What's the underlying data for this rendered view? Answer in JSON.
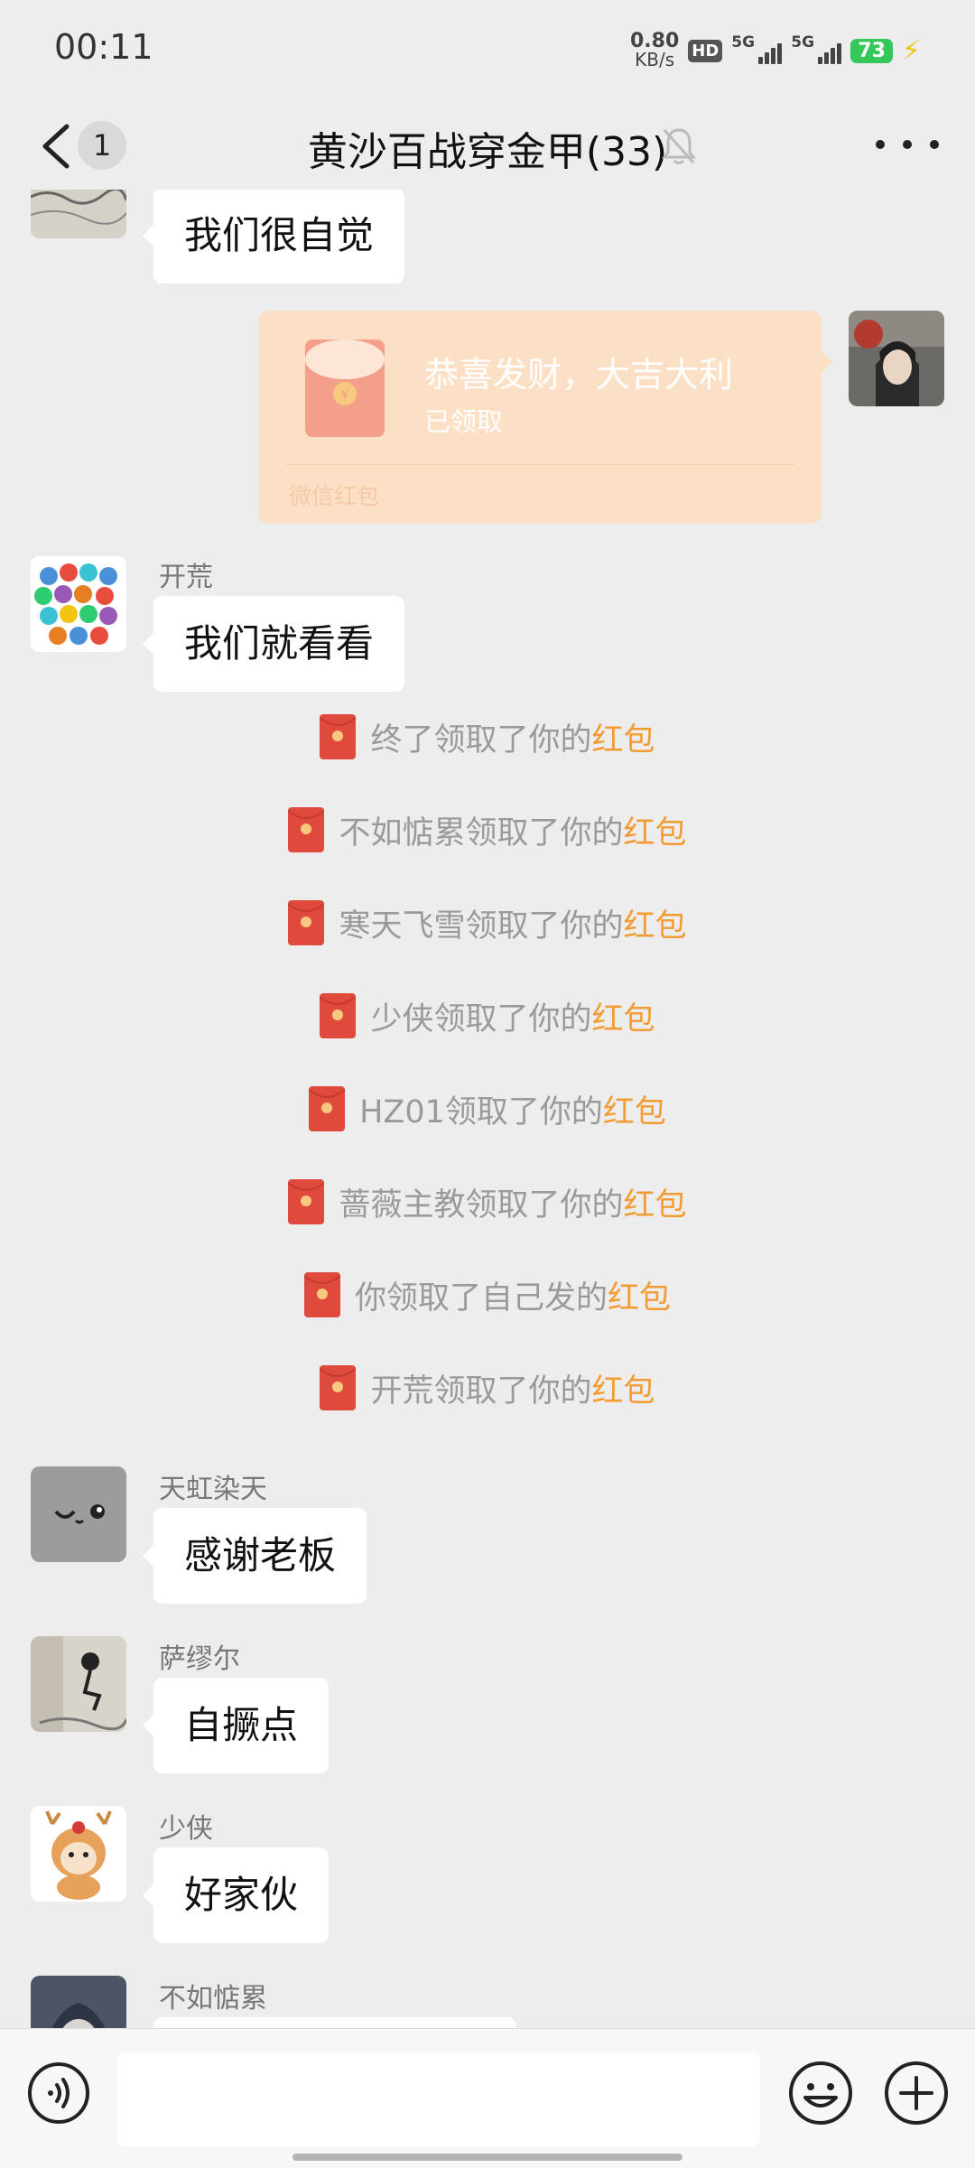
{
  "status_bar": {
    "time": "00:11",
    "net_speed_value": "0.80",
    "net_speed_unit": "KB/s",
    "hd_label": "HD",
    "signal_1_label": "5G",
    "signal_2_label": "5G",
    "battery_level": "73",
    "charging_icon": "bolt-icon"
  },
  "header": {
    "back_icon": "chevron-left-icon",
    "unread_count": "1",
    "title": "黄沙百战穿金甲(33)",
    "mute_icon": "bell-muted-icon",
    "more_icon": "ellipsis-icon"
  },
  "messages": {
    "m1": {
      "text": "我们很自觉"
    },
    "red_packet": {
      "greeting": "恭喜发财，大吉大利",
      "status": "已领取",
      "footer": "微信红包"
    },
    "m2": {
      "sender": "开荒",
      "text": "我们就看看"
    },
    "m3": {
      "sender": "天虹染天",
      "text": "感谢老板"
    },
    "m4": {
      "sender": "萨缪尔",
      "text": "自撅点"
    },
    "m5": {
      "sender": "少侠",
      "text": "好家伙"
    },
    "m6": {
      "sender": "不如惦累"
    }
  },
  "notices": [
    {
      "prefix": "终了领取了你的",
      "link": "红包"
    },
    {
      "prefix": "不如惦累领取了你的",
      "link": "红包"
    },
    {
      "prefix": "寒天飞雪领取了你的",
      "link": "红包"
    },
    {
      "prefix": "少侠领取了你的",
      "link": "红包"
    },
    {
      "prefix": "HZ01领取了你的",
      "link": "红包"
    },
    {
      "prefix": "蔷薇主教领取了你的",
      "link": "红包"
    },
    {
      "prefix": "你领取了自己发的",
      "link": "红包"
    },
    {
      "prefix": "开荒领取了你的",
      "link": "红包"
    }
  ],
  "input_bar": {
    "voice_icon": "voice-icon",
    "input_value": "",
    "emoji_icon": "emoji-icon",
    "plus_icon": "plus-circle-icon"
  },
  "colors": {
    "background": "#ededed",
    "bubble": "#ffffff",
    "red_packet": "#fce0c6",
    "notice_text": "#9a9a9a",
    "link": "#f39c33",
    "envelope": "#e04a3d"
  }
}
